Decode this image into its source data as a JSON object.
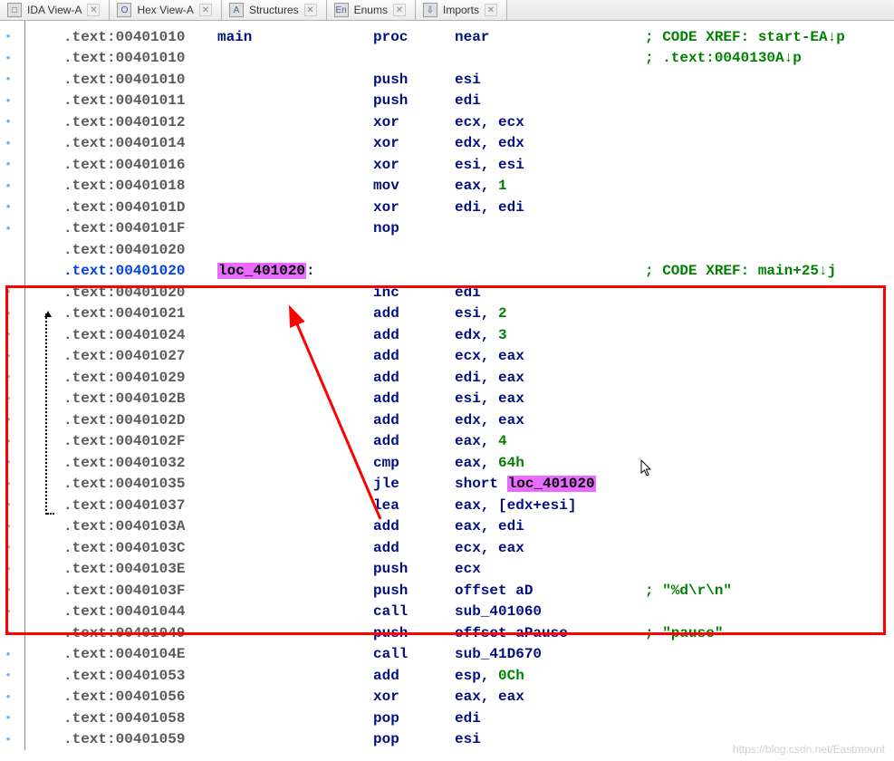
{
  "tabs": [
    {
      "label": "IDA View-A",
      "icon": "□"
    },
    {
      "label": "Hex View-A",
      "icon": "O"
    },
    {
      "label": "Structures",
      "icon": "A"
    },
    {
      "label": "Enums",
      "icon": "En"
    },
    {
      "label": "Imports",
      "icon": "⇩"
    }
  ],
  "lines": [
    {
      "dot": true,
      "addr": ".text:00401010",
      "label": "main",
      "mnem": "proc",
      "oper_reg": "near",
      "xref": "; CODE XREF: start-EA",
      "xref_dir": "down",
      "xref_tail": "p"
    },
    {
      "dot": true,
      "addr": ".text:00401010",
      "xref": "; .text:0040130A",
      "xref_dir": "down",
      "xref_tail": "p"
    },
    {
      "dot": true,
      "addr": ".text:00401010",
      "mnem": "push",
      "oper_reg": "esi"
    },
    {
      "dot": true,
      "addr": ".text:00401011",
      "mnem": "push",
      "oper_reg": "edi"
    },
    {
      "dot": true,
      "addr": ".text:00401012",
      "mnem": "xor",
      "oper_reg": "ecx, ecx"
    },
    {
      "dot": true,
      "addr": ".text:00401014",
      "mnem": "xor",
      "oper_reg": "edx, edx"
    },
    {
      "dot": true,
      "addr": ".text:00401016",
      "mnem": "xor",
      "oper_reg": "esi, esi"
    },
    {
      "dot": true,
      "addr": ".text:00401018",
      "mnem": "mov",
      "oper_regpfx": "eax, ",
      "oper_num": "1"
    },
    {
      "dot": true,
      "addr": ".text:0040101D",
      "mnem": "xor",
      "oper_reg": "edi, edi"
    },
    {
      "dot": true,
      "addr": ".text:0040101F",
      "mnem": "nop"
    },
    {
      "dot": false,
      "addr": ".text:00401020"
    },
    {
      "dot": false,
      "addr": ".text:00401020",
      "addr_link": true,
      "hl_label": "loc_401020",
      "label_colon": ":",
      "xref": "; CODE XREF: main+25",
      "xref_dir": "down",
      "xref_tail": "j"
    },
    {
      "dot": true,
      "addr": ".text:00401020",
      "mnem": "inc",
      "oper_reg": "edi"
    },
    {
      "dot": true,
      "addr": ".text:00401021",
      "mnem": "add",
      "oper_regpfx": "esi, ",
      "oper_num": "2"
    },
    {
      "dot": true,
      "addr": ".text:00401024",
      "mnem": "add",
      "oper_regpfx": "edx, ",
      "oper_num": "3"
    },
    {
      "dot": true,
      "addr": ".text:00401027",
      "mnem": "add",
      "oper_reg": "ecx, eax"
    },
    {
      "dot": true,
      "addr": ".text:00401029",
      "mnem": "add",
      "oper_reg": "edi, eax"
    },
    {
      "dot": true,
      "addr": ".text:0040102B",
      "mnem": "add",
      "oper_reg": "esi, eax"
    },
    {
      "dot": true,
      "addr": ".text:0040102D",
      "mnem": "add",
      "oper_reg": "edx, eax"
    },
    {
      "dot": true,
      "addr": ".text:0040102F",
      "mnem": "add",
      "oper_regpfx": "eax, ",
      "oper_num": "4"
    },
    {
      "dot": true,
      "addr": ".text:00401032",
      "mnem": "cmp",
      "oper_regpfx": "eax, ",
      "oper_num": "64h"
    },
    {
      "dot": true,
      "addr": ".text:00401035",
      "mnem": "jle",
      "oper_sympfx": "short ",
      "oper_hlsym": "loc_401020"
    },
    {
      "dot": true,
      "addr": ".text:00401037",
      "mnem": "lea",
      "oper_reg": "eax, [edx+esi]"
    },
    {
      "dot": true,
      "addr": ".text:0040103A",
      "mnem": "add",
      "oper_reg": "eax, edi"
    },
    {
      "dot": true,
      "addr": ".text:0040103C",
      "mnem": "add",
      "oper_reg": "ecx, eax"
    },
    {
      "dot": true,
      "addr": ".text:0040103E",
      "mnem": "push",
      "oper_reg": "ecx"
    },
    {
      "dot": true,
      "addr": ".text:0040103F",
      "mnem": "push",
      "oper_sym": "offset aD",
      "cmt": "; \"%d\\r\\n\""
    },
    {
      "dot": true,
      "addr": ".text:00401044",
      "mnem": "call",
      "oper_sym": "sub_401060"
    },
    {
      "dot": true,
      "addr": ".text:00401049",
      "mnem": "push",
      "oper_sym": "offset aPause",
      "cmt": "; \"pause\""
    },
    {
      "dot": true,
      "addr": ".text:0040104E",
      "mnem": "call",
      "oper_sym": "sub_41D670"
    },
    {
      "dot": true,
      "addr": ".text:00401053",
      "mnem": "add",
      "oper_regpfx": "esp, ",
      "oper_num": "0Ch"
    },
    {
      "dot": true,
      "addr": ".text:00401056",
      "mnem": "xor",
      "oper_reg": "eax, eax"
    },
    {
      "dot": true,
      "addr": ".text:00401058",
      "mnem": "pop",
      "oper_reg": "edi"
    },
    {
      "dot": true,
      "addr": ".text:00401059",
      "mnem": "pop",
      "oper_reg": "esi"
    }
  ],
  "watermark": "https://blog.csdn.net/Eastmount"
}
